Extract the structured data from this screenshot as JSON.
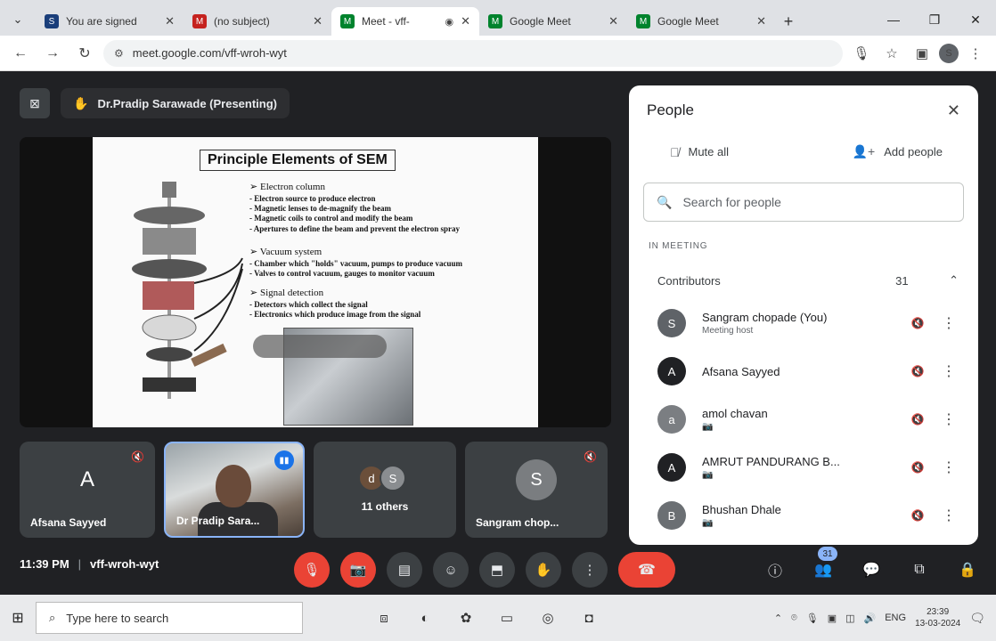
{
  "browser": {
    "tabs": [
      {
        "title": "You are signed",
        "favicon": "S",
        "favicon_color": "#1a3e7a",
        "active": false
      },
      {
        "title": "(no subject)",
        "favicon": "M",
        "favicon_color": "#c5221f",
        "active": false
      },
      {
        "title": "Meet - vff-",
        "favicon": "M",
        "favicon_color": "#00832d",
        "active": true
      },
      {
        "title": "Google Meet",
        "favicon": "M",
        "favicon_color": "#00832d",
        "active": false
      },
      {
        "title": "Google Meet",
        "favicon": "M",
        "favicon_color": "#00832d",
        "active": false
      }
    ],
    "url": "meet.google.com/vff-wroh-wyt"
  },
  "meeting": {
    "presenter_banner": "Dr.Pradip Sarawade (Presenting)",
    "time": "11:39 PM",
    "code": "vff-wroh-wyt"
  },
  "slide": {
    "title": "Principle Elements of SEM",
    "sections": [
      {
        "heading": "Electron column",
        "points": [
          "- Electron source to produce electron",
          "- Magnetic lenses to de-magnify the beam",
          "- Magnetic coils to control and modify the beam",
          "- Apertures to define the beam and prevent the electron spray"
        ]
      },
      {
        "heading": "Vacuum system",
        "points": [
          "- Chamber which \"holds\" vacuum, pumps to produce vacuum",
          "- Valves to control vacuum, gauges to monitor vacuum"
        ]
      },
      {
        "heading": "Signal detection",
        "points": [
          "- Detectors which collect the signal",
          "- Electronics which produce image from the signal"
        ]
      }
    ]
  },
  "tiles": [
    {
      "name": "Afsana Sayyed",
      "initial": "A",
      "color": "#5f6368",
      "type": "avatar"
    },
    {
      "name": "Dr Pradip Sara...",
      "type": "video"
    },
    {
      "name": "11 others",
      "type": "others",
      "avatars": [
        "d",
        "S"
      ]
    },
    {
      "name": "Sangram chop...",
      "initial": "S",
      "color": "#7a7d80",
      "type": "avatar"
    }
  ],
  "people_panel": {
    "title": "People",
    "mute_all": "Mute all",
    "add_people": "Add people",
    "search_placeholder": "Search for people",
    "section_label": "IN MEETING",
    "contributors_label": "Contributors",
    "contributors_count": "31",
    "participants": [
      {
        "name": "Sangram chopade (You)",
        "sub": "Meeting host",
        "initial": "S",
        "color": "#5f6368"
      },
      {
        "name": "Afsana Sayyed",
        "sub": "",
        "initial": "A",
        "color": "#202124"
      },
      {
        "name": "amol chavan",
        "sub": "",
        "initial": "a",
        "color": "#7b7e82"
      },
      {
        "name": "AMRUT PANDURANG B...",
        "sub": "",
        "initial": "A",
        "color": "#202124"
      },
      {
        "name": "Bhushan Dhale",
        "sub": "",
        "initial": "B",
        "color": "#6b6f73"
      }
    ]
  },
  "people_badge": "31",
  "taskbar": {
    "search_placeholder": "Type here to search",
    "lang": "ENG",
    "clock_time": "23:39",
    "clock_date": "13-03-2024"
  }
}
